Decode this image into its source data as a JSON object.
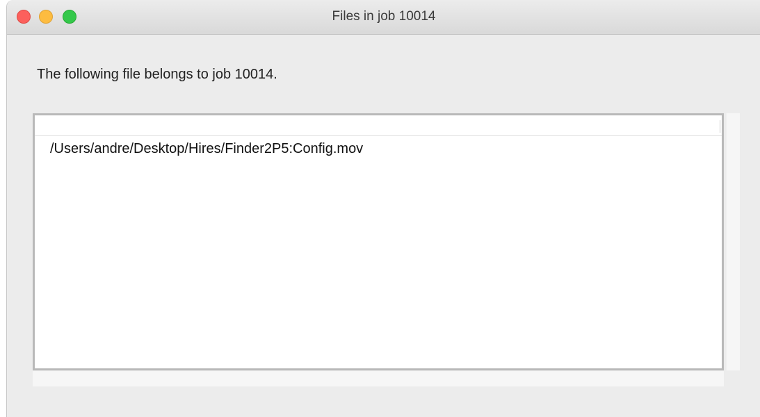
{
  "window": {
    "title": "Files in job 10014"
  },
  "main": {
    "message": "The following file belongs to job 10014.",
    "file_list": {
      "header": "",
      "rows": [
        "/Users/andre/Desktop/Hires/Finder2P5:Config.mov"
      ]
    }
  },
  "colors": {
    "close": "#fc605c",
    "minimize": "#fdbc40",
    "maximize": "#34c84a"
  }
}
